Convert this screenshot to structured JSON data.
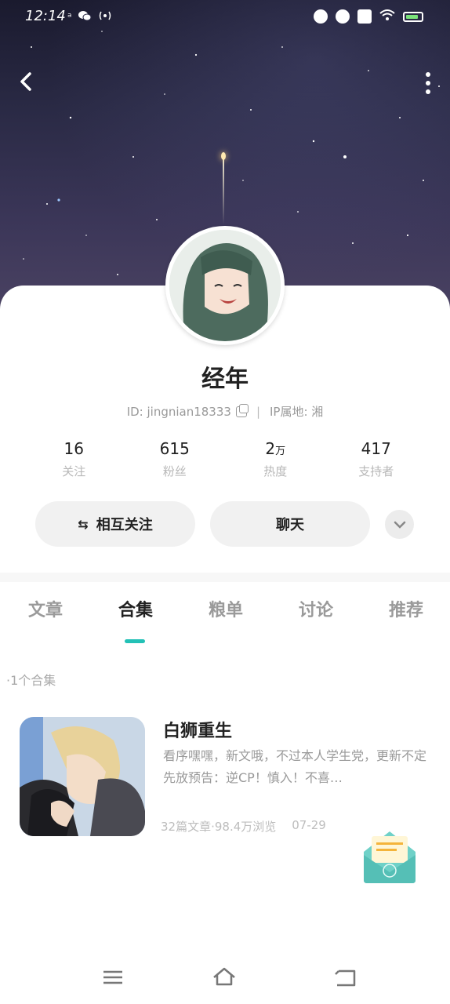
{
  "status_bar": {
    "time": "12:14",
    "left_icons": [
      "sim-icon",
      "wechat-icon",
      "hotspot-icon"
    ],
    "right_icons": [
      "alarm-icon",
      "mute-icon",
      "notification-off-icon",
      "wifi-icon",
      "battery-icon"
    ]
  },
  "header": {
    "back_icon": "chevron-left-icon",
    "more_icon": "more-vertical-icon"
  },
  "profile": {
    "name": "经年",
    "id_label": "ID: jingnian18333",
    "ip_label": "IP属地: 湘",
    "separator": "|",
    "stats": [
      {
        "num": "16",
        "unit": "",
        "label": "关注"
      },
      {
        "num": "615",
        "unit": "",
        "label": "粉丝"
      },
      {
        "num": "2",
        "unit": "万",
        "label": "热度"
      },
      {
        "num": "417",
        "unit": "",
        "label": "支持者"
      }
    ],
    "follow_button": "相互关注",
    "chat_button": "聊天"
  },
  "tabs": [
    {
      "label": "文章",
      "active": false
    },
    {
      "label": "合集",
      "active": true
    },
    {
      "label": "粮单",
      "active": false
    },
    {
      "label": "讨论",
      "active": false
    },
    {
      "label": "推荐",
      "active": false
    }
  ],
  "collections": {
    "count_label": "·1个合集",
    "items": [
      {
        "title": "白狮重生",
        "description": "看序嘿嘿，新文哦，不过本人学生党，更新不定先放预告：逆CP！慎入！不喜…",
        "stats": "32篇文章·98.4万浏览",
        "date": "07-29"
      }
    ]
  },
  "colors": {
    "accent": "#23c1b6",
    "sky": "#2a2a45"
  }
}
